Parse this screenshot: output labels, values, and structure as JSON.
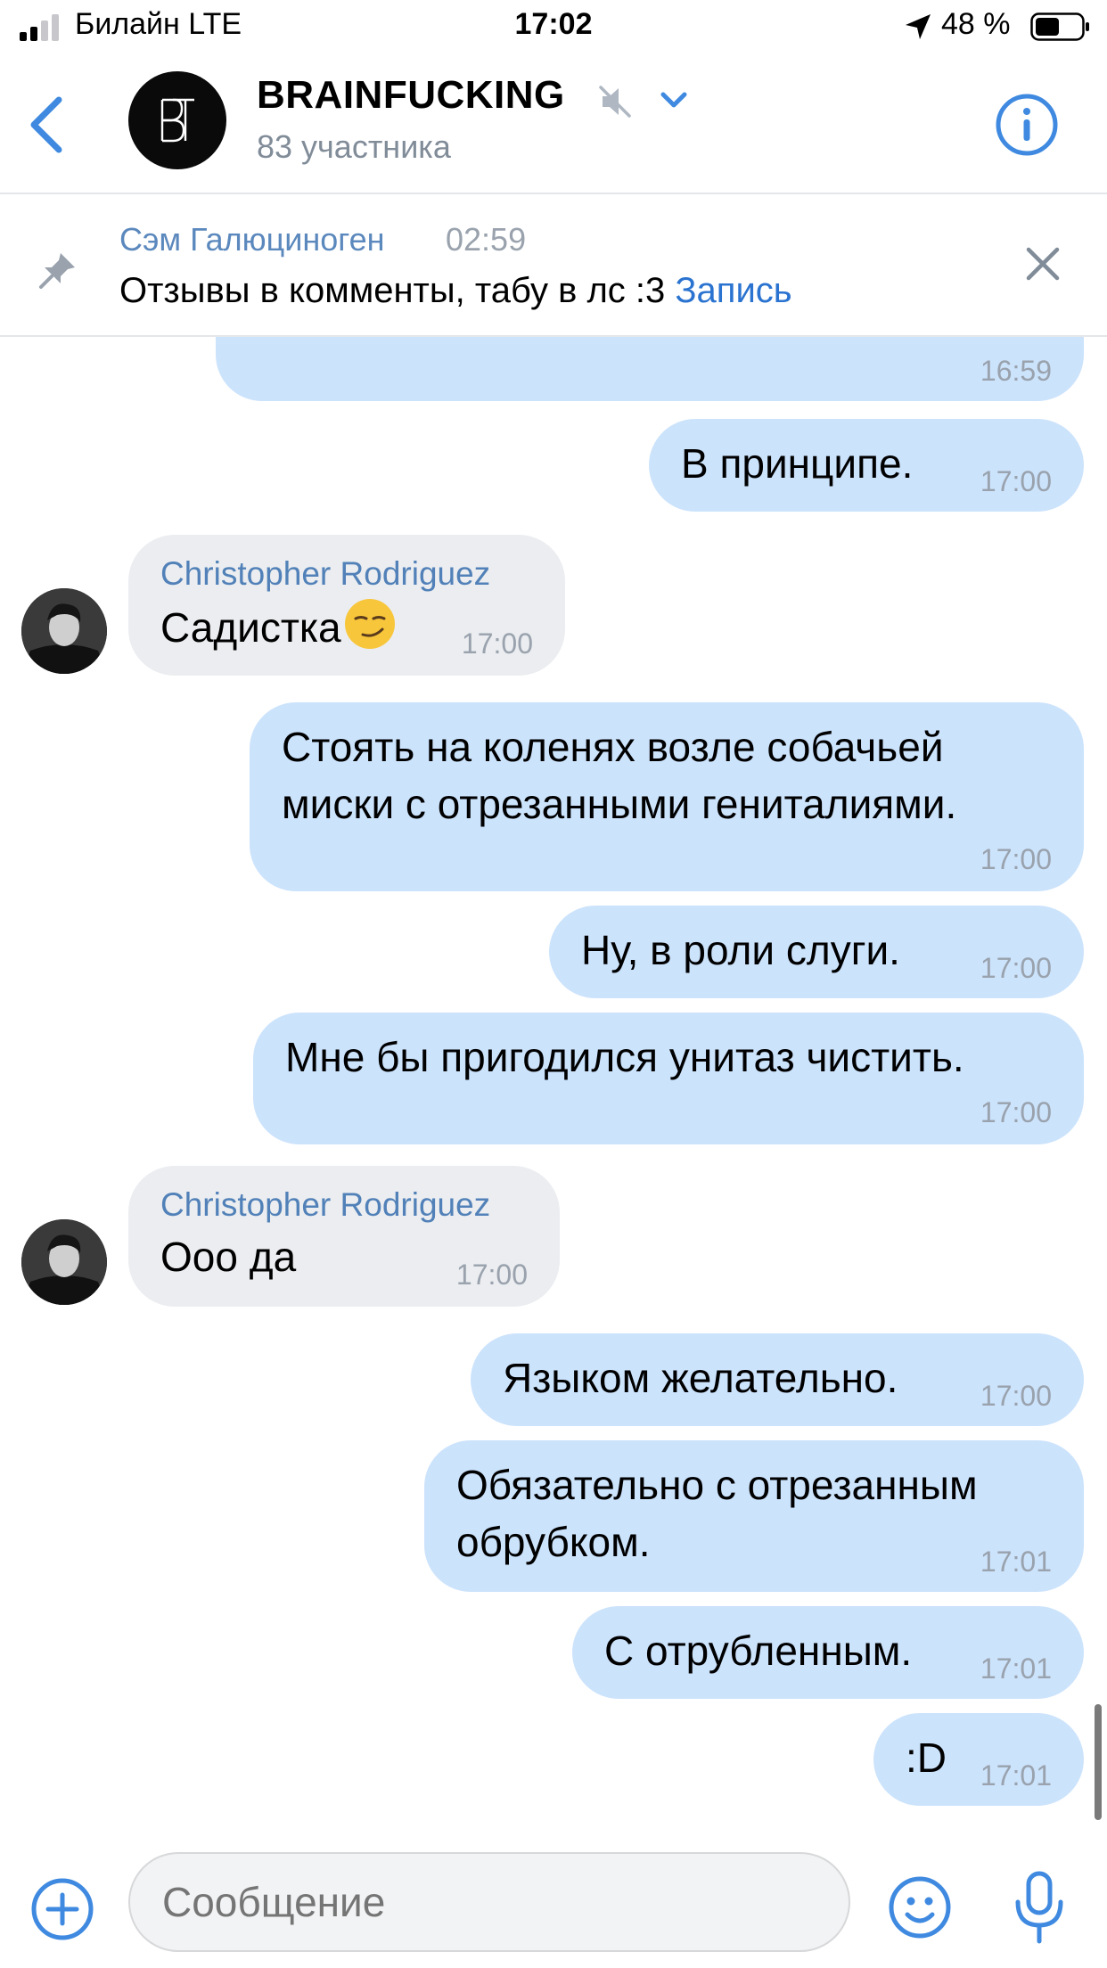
{
  "status_bar": {
    "carrier": "Билайн  LTE",
    "time": "17:02",
    "battery": "48 %"
  },
  "header": {
    "title": "BRAINFUCKING",
    "subtitle": "83 участника",
    "avatar_icon": "brand-logo-icon",
    "accent": "#3f8ae0"
  },
  "pinned": {
    "author": "Сэм Галюциноген",
    "time": "02:59",
    "text": "Отзывы в комменты, табу в лс :3 ",
    "link": "Запись"
  },
  "messages": [
    {
      "dir": "out",
      "text": "",
      "time": "16:59"
    },
    {
      "dir": "out",
      "text": "В принципе.",
      "time": "17:00"
    },
    {
      "dir": "in",
      "sender": "Christopher Rodriguez",
      "text": "Садистка",
      "emoji": "smirk-emoji",
      "time": "17:00"
    },
    {
      "dir": "out",
      "lines": [
        "Стоять на коленях возле собачьей",
        "миски с отрезанными гениталиями."
      ],
      "time": "17:00"
    },
    {
      "dir": "out",
      "text": "Ну, в роли слуги.",
      "time": "17:00"
    },
    {
      "dir": "out",
      "text": "Мне бы пригодился унитаз чистить.",
      "time": "17:00"
    },
    {
      "dir": "in",
      "sender": "Christopher Rodriguez",
      "text": "Ооо да",
      "time": "17:00"
    },
    {
      "dir": "out",
      "text": "Языком желательно.",
      "time": "17:00"
    },
    {
      "dir": "out",
      "lines": [
        "Обязательно с отрезанным",
        "обрубком."
      ],
      "time": "17:01"
    },
    {
      "dir": "out",
      "text": "С отрубленным.",
      "time": "17:01"
    },
    {
      "dir": "out",
      "text": ":D",
      "time": "17:01"
    }
  ],
  "composer": {
    "placeholder": "Сообщение"
  },
  "colors": {
    "outgoing_bubble": "#cce3fc",
    "incoming_bubble": "#ebedf0",
    "link": "#2a73d0",
    "sender": "#5181b8"
  }
}
